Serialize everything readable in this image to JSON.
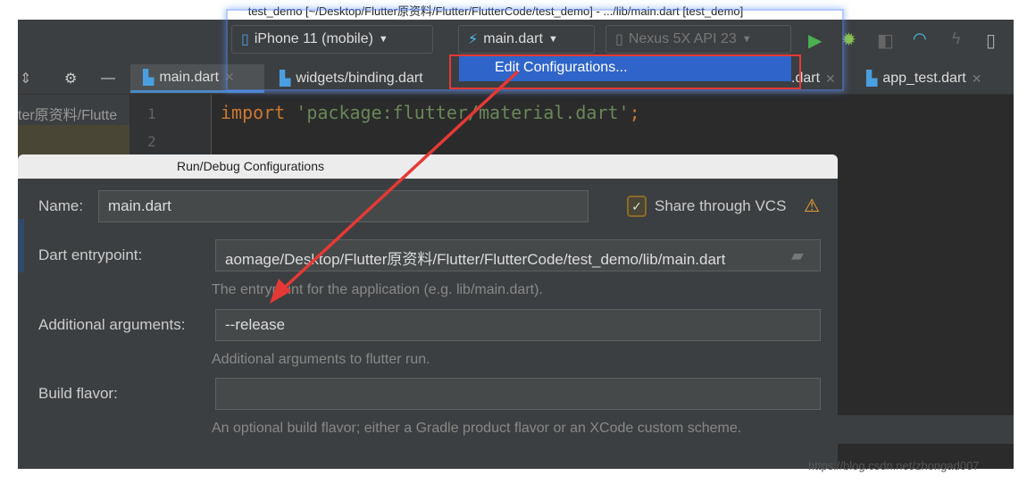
{
  "window_title": "test_demo [~/Desktop/Flutter原资料/Flutter/FlutterCode/test_demo] - .../lib/main.dart [test_demo]",
  "toolbar": {
    "device": "iPhone 11 (mobile)",
    "config": "main.dart",
    "emulator": "Nexus 5X API 23"
  },
  "dropdown": {
    "edit_configurations": "Edit Configurations..."
  },
  "tabs": [
    {
      "label": "main.dart"
    },
    {
      "label": "widgets/binding.dart"
    },
    {
      "label": ".dart"
    },
    {
      "label": "app_test.dart"
    }
  ],
  "project_path": "ter原资料/Flutte",
  "editor": {
    "line_numbers": [
      "1",
      "2"
    ],
    "keyword": "import",
    "string": "'package:flutter/material.dart'",
    "semicolon": ";"
  },
  "dialog": {
    "title": "Run/Debug Configurations",
    "name_label": "Name:",
    "name_value": "main.dart",
    "share_label": "Share through VCS",
    "share_checked": true,
    "entry_label": "Dart entrypoint:",
    "entry_value": "aomage/Desktop/Flutter原资料/Flutter/FlutterCode/test_demo/lib/main.dart",
    "entry_hint": "The entrypoint for the application (e.g. lib/main.dart).",
    "args_label": "Additional arguments:",
    "args_value": "--release",
    "args_hint": "Additional arguments to flutter run.",
    "flavor_label": "Build flavor:",
    "flavor_value": "",
    "flavor_hint": "An optional build flavor; either a Gradle product flavor or an XCode custom scheme."
  },
  "watermark": "https://blog.csdn.net/zhongad007",
  "colors": {
    "highlight": "#2f65ca",
    "annotation": "#e53935",
    "run": "#4caf50",
    "debug": "#8bc34a",
    "warning": "#f0a732"
  }
}
